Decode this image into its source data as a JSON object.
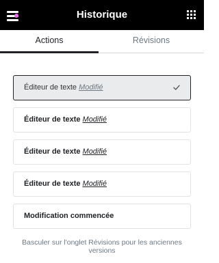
{
  "header": {
    "title": "Historique",
    "menu_icon": "hamburger-menu-icon",
    "apps_icon": "grid-apps-icon",
    "notification_color": "#e66de8"
  },
  "tabs": [
    {
      "label": "Actions",
      "active": true
    },
    {
      "label": "Révisions",
      "active": false
    }
  ],
  "history_items": [
    {
      "title": "Éditeur de texte",
      "status": "Modifié",
      "active": true,
      "icon": "check-icon"
    },
    {
      "title": "Éditeur de texte",
      "status": "Modifié",
      "active": false
    },
    {
      "title": "Éditeur de texte",
      "status": "Modifié",
      "active": false
    },
    {
      "title": "Éditeur de texte",
      "status": "Modifié",
      "active": false
    },
    {
      "title": "Modification commencée",
      "status": "",
      "active": false
    }
  ],
  "footer_note": "Basculer sur l'onglet Révisions pour les anciennes versions",
  "colors": {
    "header_bg": "#000000",
    "active_item_bg": "#eaebec",
    "muted_text": "#6d7882"
  }
}
